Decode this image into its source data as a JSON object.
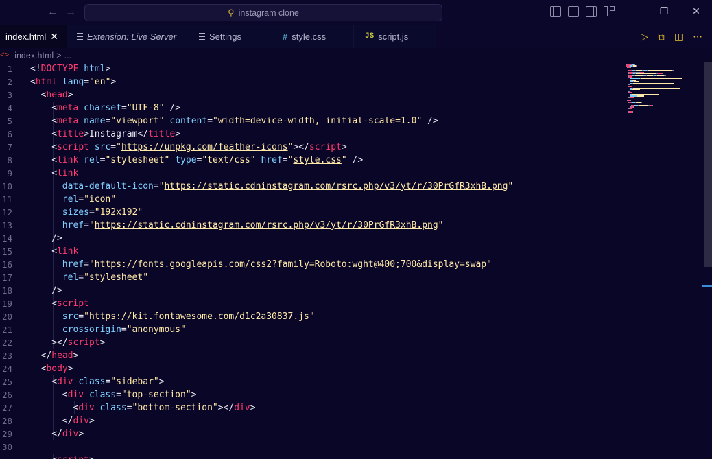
{
  "window": {
    "search_text": "instagram clone",
    "back_icon": "arrow-left",
    "forward_icon": "arrow-right",
    "search_icon": "magnifier-icon"
  },
  "tabs": [
    {
      "label": "index.html",
      "active": true,
      "icon": "html-icon",
      "italic": false
    },
    {
      "label": "Extension: Live Server",
      "active": false,
      "icon": "extension-lines-icon",
      "italic": true
    },
    {
      "label": "Settings",
      "active": false,
      "icon": "settings-lines-icon",
      "italic": false
    },
    {
      "label": "style.css",
      "active": false,
      "icon": "css-hash-icon",
      "italic": false
    },
    {
      "label": "script.js",
      "active": false,
      "icon": "js-icon",
      "italic": false
    }
  ],
  "tab_close_glyph": "✕",
  "css_icon_glyph": "#",
  "js_icon_glyph": "JS",
  "breadcrumb": {
    "icon": "<>",
    "file": "index.html",
    "sep": ">",
    "rest": "..."
  },
  "colors": {
    "background": "#0a0628",
    "tag": "#ff3a6e",
    "attribute": "#7fd0ff",
    "string": "#ffe9a8",
    "text": "#e8e8f2",
    "line_number": "#6e6c8a",
    "accent": "#e6c229"
  },
  "code_lines": [
    {
      "n": "1",
      "indent": 0,
      "tokens": [
        [
          "punc",
          "<!"
        ],
        [
          "tag",
          "DOCTYPE"
        ],
        [
          "punc",
          " "
        ],
        [
          "attr",
          "html"
        ],
        [
          "punc",
          ">"
        ]
      ]
    },
    {
      "n": "2",
      "indent": 0,
      "tokens": [
        [
          "punc",
          "<"
        ],
        [
          "tag",
          "html"
        ],
        [
          "punc",
          " "
        ],
        [
          "attr",
          "lang"
        ],
        [
          "punc",
          "="
        ],
        [
          "str",
          "\"en\""
        ],
        [
          "punc",
          ">"
        ]
      ]
    },
    {
      "n": "3",
      "indent": 1,
      "tokens": [
        [
          "punc",
          "<"
        ],
        [
          "tag",
          "head"
        ],
        [
          "punc",
          ">"
        ]
      ]
    },
    {
      "n": "4",
      "indent": 2,
      "tokens": [
        [
          "punc",
          "<"
        ],
        [
          "tag",
          "meta"
        ],
        [
          "punc",
          " "
        ],
        [
          "attr",
          "charset"
        ],
        [
          "punc",
          "="
        ],
        [
          "str",
          "\"UTF-8\""
        ],
        [
          "punc",
          " />"
        ]
      ]
    },
    {
      "n": "5",
      "indent": 2,
      "tokens": [
        [
          "punc",
          "<"
        ],
        [
          "tag",
          "meta"
        ],
        [
          "punc",
          " "
        ],
        [
          "attr",
          "name"
        ],
        [
          "punc",
          "="
        ],
        [
          "str",
          "\"viewport\""
        ],
        [
          "punc",
          " "
        ],
        [
          "attr",
          "content"
        ],
        [
          "punc",
          "="
        ],
        [
          "str",
          "\"width=device-width, initial-scale=1.0\""
        ],
        [
          "punc",
          " />"
        ]
      ]
    },
    {
      "n": "6",
      "indent": 2,
      "tokens": [
        [
          "punc",
          "<"
        ],
        [
          "tag",
          "title"
        ],
        [
          "punc",
          ">"
        ],
        [
          "punc",
          "Instagram"
        ],
        [
          "punc",
          "</"
        ],
        [
          "tag",
          "title"
        ],
        [
          "punc",
          ">"
        ]
      ]
    },
    {
      "n": "7",
      "indent": 2,
      "tokens": [
        [
          "punc",
          "<"
        ],
        [
          "tag",
          "script"
        ],
        [
          "punc",
          " "
        ],
        [
          "attr",
          "src"
        ],
        [
          "punc",
          "="
        ],
        [
          "str",
          "\""
        ],
        [
          "link",
          "https://unpkg.com/feather-icons"
        ],
        [
          "str",
          "\""
        ],
        [
          "punc",
          "></"
        ],
        [
          "tag",
          "script"
        ],
        [
          "punc",
          ">"
        ]
      ]
    },
    {
      "n": "8",
      "indent": 2,
      "tokens": [
        [
          "punc",
          "<"
        ],
        [
          "tag",
          "link"
        ],
        [
          "punc",
          " "
        ],
        [
          "attr",
          "rel"
        ],
        [
          "punc",
          "="
        ],
        [
          "str",
          "\"stylesheet\""
        ],
        [
          "punc",
          " "
        ],
        [
          "attr",
          "type"
        ],
        [
          "punc",
          "="
        ],
        [
          "str",
          "\"text/css\""
        ],
        [
          "punc",
          " "
        ],
        [
          "attr",
          "href"
        ],
        [
          "punc",
          "="
        ],
        [
          "str",
          "\""
        ],
        [
          "link",
          "style.css"
        ],
        [
          "str",
          "\""
        ],
        [
          "punc",
          " />"
        ]
      ]
    },
    {
      "n": "9",
      "indent": 2,
      "tokens": [
        [
          "punc",
          "<"
        ],
        [
          "tag",
          "link"
        ]
      ]
    },
    {
      "n": "10",
      "indent": 3,
      "tokens": [
        [
          "attr",
          "data-default-icon"
        ],
        [
          "punc",
          "="
        ],
        [
          "str",
          "\""
        ],
        [
          "link",
          "https://static.cdninstagram.com/rsrc.php/v3/yt/r/30PrGfR3xhB.png"
        ],
        [
          "str",
          "\""
        ]
      ]
    },
    {
      "n": "11",
      "indent": 3,
      "tokens": [
        [
          "attr",
          "rel"
        ],
        [
          "punc",
          "="
        ],
        [
          "str",
          "\"icon\""
        ]
      ]
    },
    {
      "n": "12",
      "indent": 3,
      "tokens": [
        [
          "attr",
          "sizes"
        ],
        [
          "punc",
          "="
        ],
        [
          "str",
          "\"192x192\""
        ]
      ]
    },
    {
      "n": "13",
      "indent": 3,
      "tokens": [
        [
          "attr",
          "href"
        ],
        [
          "punc",
          "="
        ],
        [
          "str",
          "\""
        ],
        [
          "link",
          "https://static.cdninstagram.com/rsrc.php/v3/yt/r/30PrGfR3xhB.png"
        ],
        [
          "str",
          "\""
        ]
      ]
    },
    {
      "n": "14",
      "indent": 2,
      "tokens": [
        [
          "punc",
          "/>"
        ]
      ]
    },
    {
      "n": "15",
      "indent": 2,
      "tokens": [
        [
          "punc",
          "<"
        ],
        [
          "tag",
          "link"
        ]
      ]
    },
    {
      "n": "16",
      "indent": 3,
      "tokens": [
        [
          "attr",
          "href"
        ],
        [
          "punc",
          "="
        ],
        [
          "str",
          "\""
        ],
        [
          "link",
          "https://fonts.googleapis.com/css2?family=Roboto:wght@400;700&display=swap"
        ],
        [
          "str",
          "\""
        ]
      ]
    },
    {
      "n": "17",
      "indent": 3,
      "tokens": [
        [
          "attr",
          "rel"
        ],
        [
          "punc",
          "="
        ],
        [
          "str",
          "\"stylesheet\""
        ]
      ]
    },
    {
      "n": "18",
      "indent": 2,
      "tokens": [
        [
          "punc",
          "/>"
        ]
      ]
    },
    {
      "n": "19",
      "indent": 2,
      "tokens": [
        [
          "punc",
          "<"
        ],
        [
          "tag",
          "script"
        ]
      ]
    },
    {
      "n": "20",
      "indent": 3,
      "tokens": [
        [
          "attr",
          "src"
        ],
        [
          "punc",
          "="
        ],
        [
          "str",
          "\""
        ],
        [
          "link",
          "https://kit.fontawesome.com/d1c2a30837.js"
        ],
        [
          "str",
          "\""
        ]
      ]
    },
    {
      "n": "21",
      "indent": 3,
      "tokens": [
        [
          "attr",
          "crossorigin"
        ],
        [
          "punc",
          "="
        ],
        [
          "str",
          "\"anonymous\""
        ]
      ]
    },
    {
      "n": "22",
      "indent": 2,
      "tokens": [
        [
          "punc",
          "></"
        ],
        [
          "tag",
          "script"
        ],
        [
          "punc",
          ">"
        ]
      ]
    },
    {
      "n": "23",
      "indent": 1,
      "tokens": [
        [
          "punc",
          "</"
        ],
        [
          "tag",
          "head"
        ],
        [
          "punc",
          ">"
        ]
      ]
    },
    {
      "n": "24",
      "indent": 1,
      "tokens": [
        [
          "punc",
          "<"
        ],
        [
          "tag",
          "body"
        ],
        [
          "punc",
          ">"
        ]
      ]
    },
    {
      "n": "25",
      "indent": 2,
      "tokens": [
        [
          "punc",
          "<"
        ],
        [
          "tag",
          "div"
        ],
        [
          "punc",
          " "
        ],
        [
          "attr",
          "class"
        ],
        [
          "punc",
          "="
        ],
        [
          "str",
          "\"sidebar\""
        ],
        [
          "punc",
          ">"
        ]
      ]
    },
    {
      "n": "26",
      "indent": 3,
      "tokens": [
        [
          "punc",
          "<"
        ],
        [
          "tag",
          "div"
        ],
        [
          "punc",
          " "
        ],
        [
          "attr",
          "class"
        ],
        [
          "punc",
          "="
        ],
        [
          "str",
          "\"top-section\""
        ],
        [
          "punc",
          ">"
        ]
      ]
    },
    {
      "n": "27",
      "indent": 4,
      "tokens": [
        [
          "punc",
          "<"
        ],
        [
          "tag",
          "div"
        ],
        [
          "punc",
          " "
        ],
        [
          "attr",
          "class"
        ],
        [
          "punc",
          "="
        ],
        [
          "str",
          "\"bottom-section\""
        ],
        [
          "punc",
          "></"
        ],
        [
          "tag",
          "div"
        ],
        [
          "punc",
          ">"
        ]
      ]
    },
    {
      "n": "28",
      "indent": 3,
      "tokens": [
        [
          "punc",
          "</"
        ],
        [
          "tag",
          "div"
        ],
        [
          "punc",
          ">"
        ]
      ]
    },
    {
      "n": "29",
      "indent": 2,
      "tokens": [
        [
          "punc",
          "</"
        ],
        [
          "tag",
          "div"
        ],
        [
          "punc",
          ">"
        ]
      ]
    },
    {
      "n": "30",
      "indent": 0,
      "tokens": []
    },
    {
      "n": "",
      "indent": 2,
      "tokens": [
        [
          "punc",
          "<"
        ],
        [
          "tag",
          "script"
        ],
        [
          "punc",
          ">"
        ]
      ]
    }
  ]
}
